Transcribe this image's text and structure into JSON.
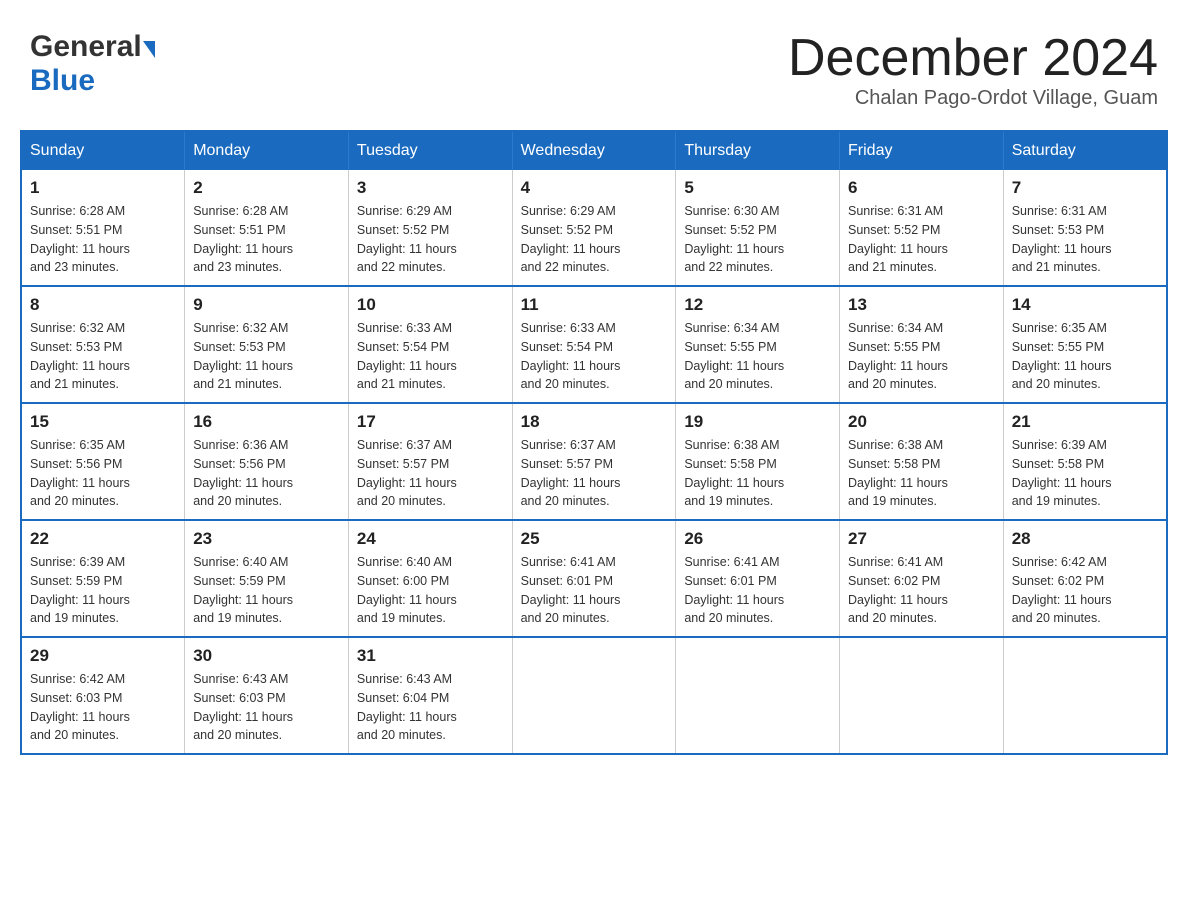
{
  "header": {
    "logo_general": "General",
    "logo_blue": "Blue",
    "month_title": "December 2024",
    "location": "Chalan Pago-Ordot Village, Guam"
  },
  "weekdays": [
    "Sunday",
    "Monday",
    "Tuesday",
    "Wednesday",
    "Thursday",
    "Friday",
    "Saturday"
  ],
  "weeks": [
    [
      {
        "day": "1",
        "sunrise": "6:28 AM",
        "sunset": "5:51 PM",
        "daylight": "11 hours and 23 minutes."
      },
      {
        "day": "2",
        "sunrise": "6:28 AM",
        "sunset": "5:51 PM",
        "daylight": "11 hours and 23 minutes."
      },
      {
        "day": "3",
        "sunrise": "6:29 AM",
        "sunset": "5:52 PM",
        "daylight": "11 hours and 22 minutes."
      },
      {
        "day": "4",
        "sunrise": "6:29 AM",
        "sunset": "5:52 PM",
        "daylight": "11 hours and 22 minutes."
      },
      {
        "day": "5",
        "sunrise": "6:30 AM",
        "sunset": "5:52 PM",
        "daylight": "11 hours and 22 minutes."
      },
      {
        "day": "6",
        "sunrise": "6:31 AM",
        "sunset": "5:52 PM",
        "daylight": "11 hours and 21 minutes."
      },
      {
        "day": "7",
        "sunrise": "6:31 AM",
        "sunset": "5:53 PM",
        "daylight": "11 hours and 21 minutes."
      }
    ],
    [
      {
        "day": "8",
        "sunrise": "6:32 AM",
        "sunset": "5:53 PM",
        "daylight": "11 hours and 21 minutes."
      },
      {
        "day": "9",
        "sunrise": "6:32 AM",
        "sunset": "5:53 PM",
        "daylight": "11 hours and 21 minutes."
      },
      {
        "day": "10",
        "sunrise": "6:33 AM",
        "sunset": "5:54 PM",
        "daylight": "11 hours and 21 minutes."
      },
      {
        "day": "11",
        "sunrise": "6:33 AM",
        "sunset": "5:54 PM",
        "daylight": "11 hours and 20 minutes."
      },
      {
        "day": "12",
        "sunrise": "6:34 AM",
        "sunset": "5:55 PM",
        "daylight": "11 hours and 20 minutes."
      },
      {
        "day": "13",
        "sunrise": "6:34 AM",
        "sunset": "5:55 PM",
        "daylight": "11 hours and 20 minutes."
      },
      {
        "day": "14",
        "sunrise": "6:35 AM",
        "sunset": "5:55 PM",
        "daylight": "11 hours and 20 minutes."
      }
    ],
    [
      {
        "day": "15",
        "sunrise": "6:35 AM",
        "sunset": "5:56 PM",
        "daylight": "11 hours and 20 minutes."
      },
      {
        "day": "16",
        "sunrise": "6:36 AM",
        "sunset": "5:56 PM",
        "daylight": "11 hours and 20 minutes."
      },
      {
        "day": "17",
        "sunrise": "6:37 AM",
        "sunset": "5:57 PM",
        "daylight": "11 hours and 20 minutes."
      },
      {
        "day": "18",
        "sunrise": "6:37 AM",
        "sunset": "5:57 PM",
        "daylight": "11 hours and 20 minutes."
      },
      {
        "day": "19",
        "sunrise": "6:38 AM",
        "sunset": "5:58 PM",
        "daylight": "11 hours and 19 minutes."
      },
      {
        "day": "20",
        "sunrise": "6:38 AM",
        "sunset": "5:58 PM",
        "daylight": "11 hours and 19 minutes."
      },
      {
        "day": "21",
        "sunrise": "6:39 AM",
        "sunset": "5:58 PM",
        "daylight": "11 hours and 19 minutes."
      }
    ],
    [
      {
        "day": "22",
        "sunrise": "6:39 AM",
        "sunset": "5:59 PM",
        "daylight": "11 hours and 19 minutes."
      },
      {
        "day": "23",
        "sunrise": "6:40 AM",
        "sunset": "5:59 PM",
        "daylight": "11 hours and 19 minutes."
      },
      {
        "day": "24",
        "sunrise": "6:40 AM",
        "sunset": "6:00 PM",
        "daylight": "11 hours and 19 minutes."
      },
      {
        "day": "25",
        "sunrise": "6:41 AM",
        "sunset": "6:01 PM",
        "daylight": "11 hours and 20 minutes."
      },
      {
        "day": "26",
        "sunrise": "6:41 AM",
        "sunset": "6:01 PM",
        "daylight": "11 hours and 20 minutes."
      },
      {
        "day": "27",
        "sunrise": "6:41 AM",
        "sunset": "6:02 PM",
        "daylight": "11 hours and 20 minutes."
      },
      {
        "day": "28",
        "sunrise": "6:42 AM",
        "sunset": "6:02 PM",
        "daylight": "11 hours and 20 minutes."
      }
    ],
    [
      {
        "day": "29",
        "sunrise": "6:42 AM",
        "sunset": "6:03 PM",
        "daylight": "11 hours and 20 minutes."
      },
      {
        "day": "30",
        "sunrise": "6:43 AM",
        "sunset": "6:03 PM",
        "daylight": "11 hours and 20 minutes."
      },
      {
        "day": "31",
        "sunrise": "6:43 AM",
        "sunset": "6:04 PM",
        "daylight": "11 hours and 20 minutes."
      },
      null,
      null,
      null,
      null
    ]
  ],
  "labels": {
    "sunrise": "Sunrise:",
    "sunset": "Sunset:",
    "daylight": "Daylight:"
  }
}
